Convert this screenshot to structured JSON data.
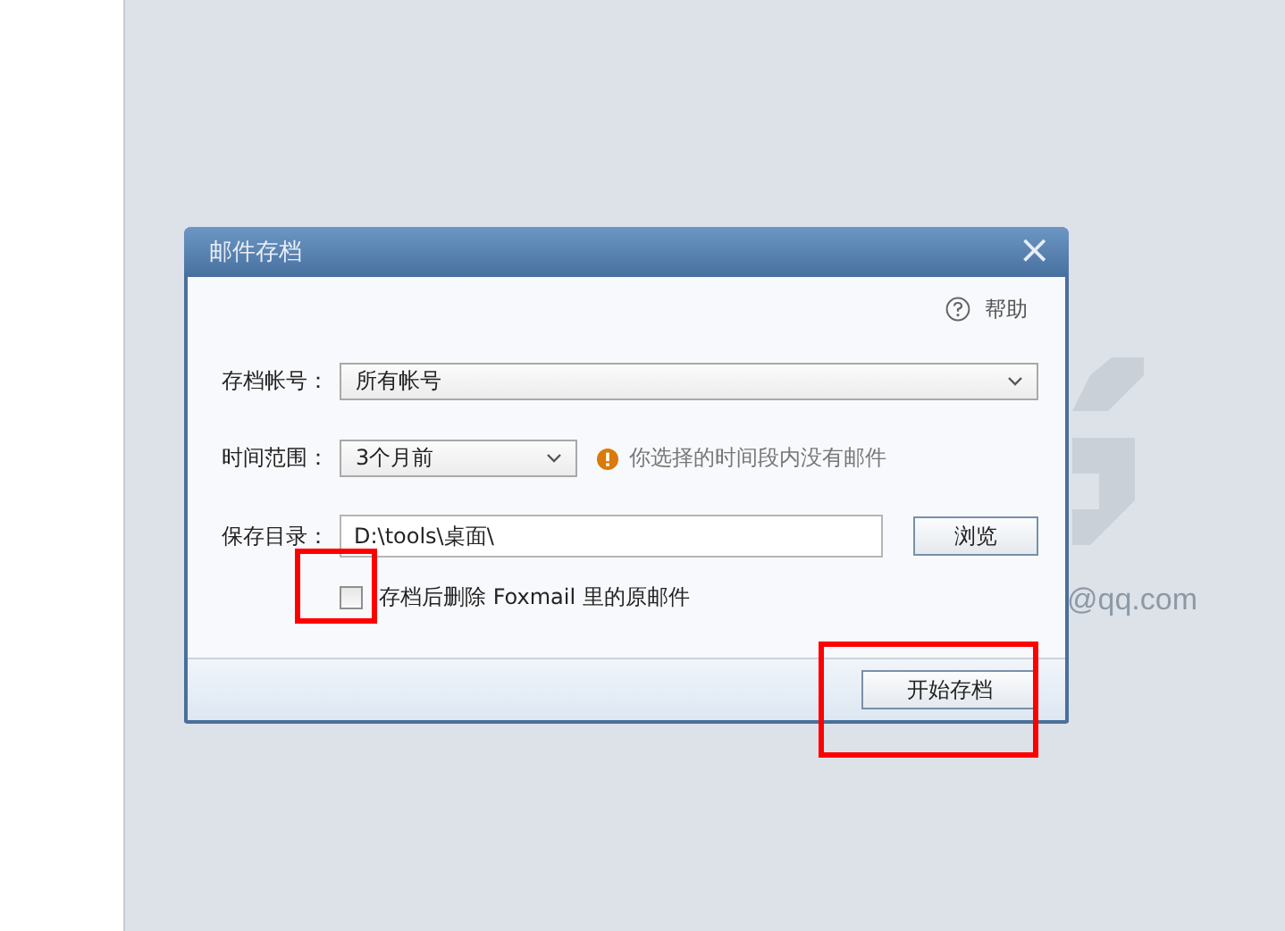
{
  "background": {
    "account_suffix": "@qq.com"
  },
  "dialog": {
    "title": "邮件存档",
    "close": "×",
    "help": "帮助",
    "account": {
      "label": "存档帐号：",
      "value": "所有帐号"
    },
    "time_range": {
      "label": "时间范围：",
      "value": "3个月前",
      "warning": "你选择的时间段内没有邮件"
    },
    "directory": {
      "label": "保存目录：",
      "value": "D:\\tools\\桌面\\",
      "browse": "浏览"
    },
    "delete_option": {
      "label": "存档后删除 Foxmail 里的原邮件",
      "checked": false
    },
    "start_button": "开始存档"
  }
}
